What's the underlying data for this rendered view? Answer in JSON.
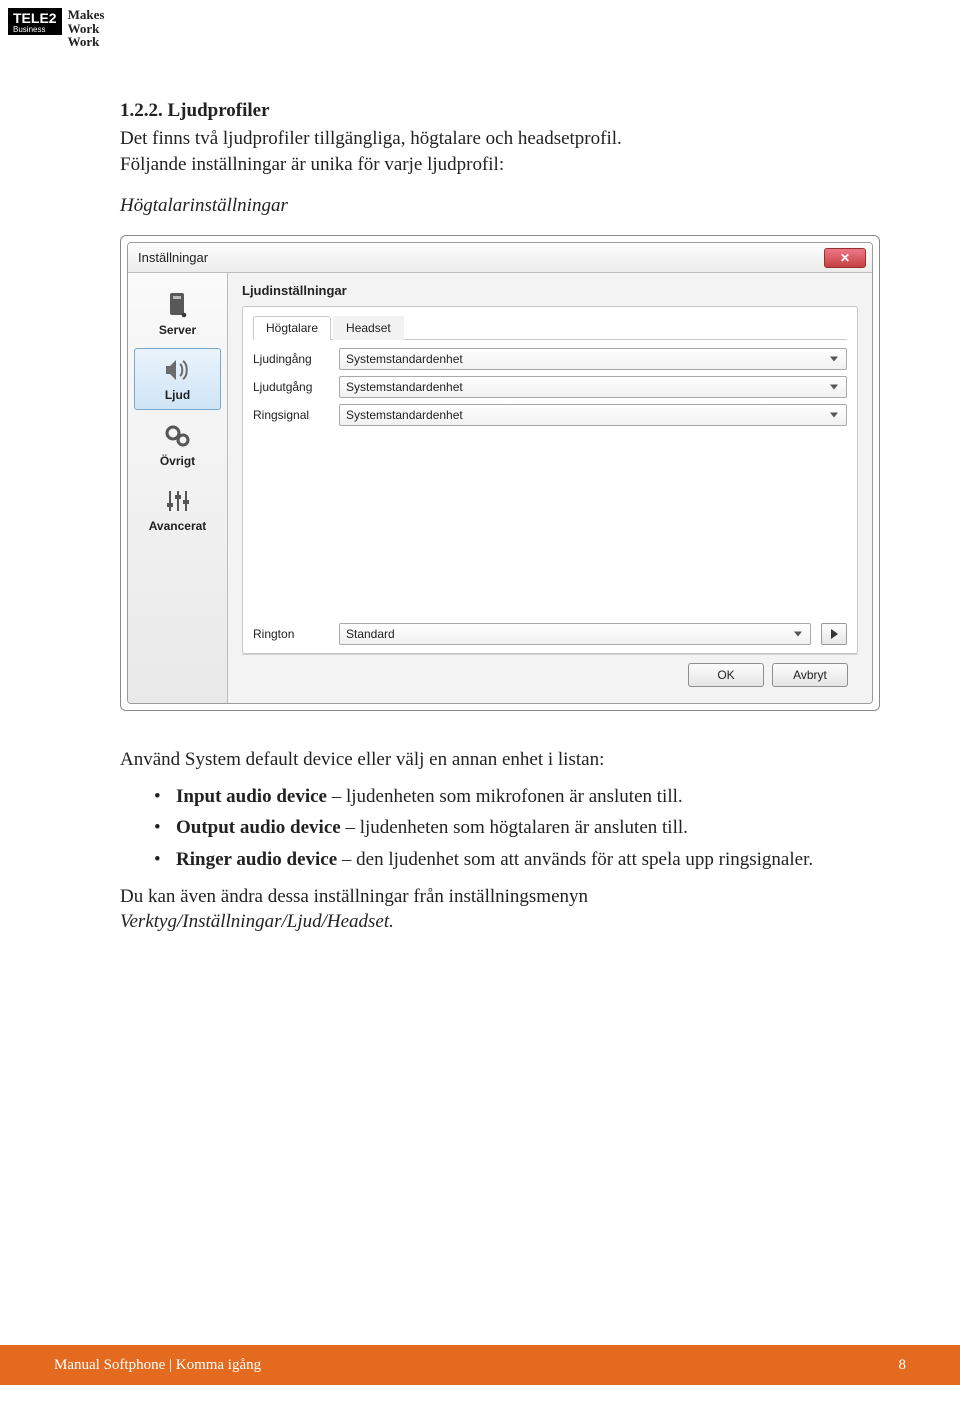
{
  "logo": {
    "brand_top": "TELE2",
    "brand_sub": "Business",
    "slogan_l1": "Makes",
    "slogan_l2": "Work",
    "slogan_l3": "Work"
  },
  "doc": {
    "heading_number": "1.2.2.",
    "heading_title": "Ljudprofiler",
    "intro_line1": "Det finns två ljudprofiler tillgängliga, högtalare och headsetprofil.",
    "intro_line2": "Följande inställningar är unika för varje ljudprofil:",
    "subheading": "Högtalarinställningar",
    "after_dialog_para": "Använd System default device eller välj en annan enhet i listan:",
    "bullets": [
      {
        "b": "Input audio device",
        "t": " – ljudenheten som mikrofonen är ansluten till."
      },
      {
        "b": "Output audio device",
        "t": " – ljudenheten som högtalaren är ansluten till."
      },
      {
        "b": "Ringer audio device",
        "t": " – den ljudenhet som att används för att spela upp ringsignaler."
      }
    ],
    "closing_l1": "Du kan även ändra dessa inställningar från inställningsmenyn",
    "closing_l2": "Verktyg/Inställningar/Ljud/Headset."
  },
  "dialog": {
    "title": "Inställningar",
    "close_glyph": "✕",
    "sidebar": [
      {
        "label": "Server"
      },
      {
        "label": "Ljud"
      },
      {
        "label": "Övrigt"
      },
      {
        "label": "Avancerat"
      }
    ],
    "section_title": "Ljudinställningar",
    "tabs": {
      "active": "Högtalare",
      "other": "Headset"
    },
    "rows": {
      "in_label": "Ljudingång",
      "in_value": "Systemstandardenhet",
      "out_label": "Ljudutgång",
      "out_value": "Systemstandardenhet",
      "ring_label": "Ringsignal",
      "ring_value": "Systemstandardenhet"
    },
    "ringtone": {
      "label": "Rington",
      "value": "Standard"
    },
    "buttons": {
      "ok": "OK",
      "cancel": "Avbryt"
    }
  },
  "footer": {
    "text": "Manual Softphone | Komma igång",
    "page_number": "8"
  }
}
